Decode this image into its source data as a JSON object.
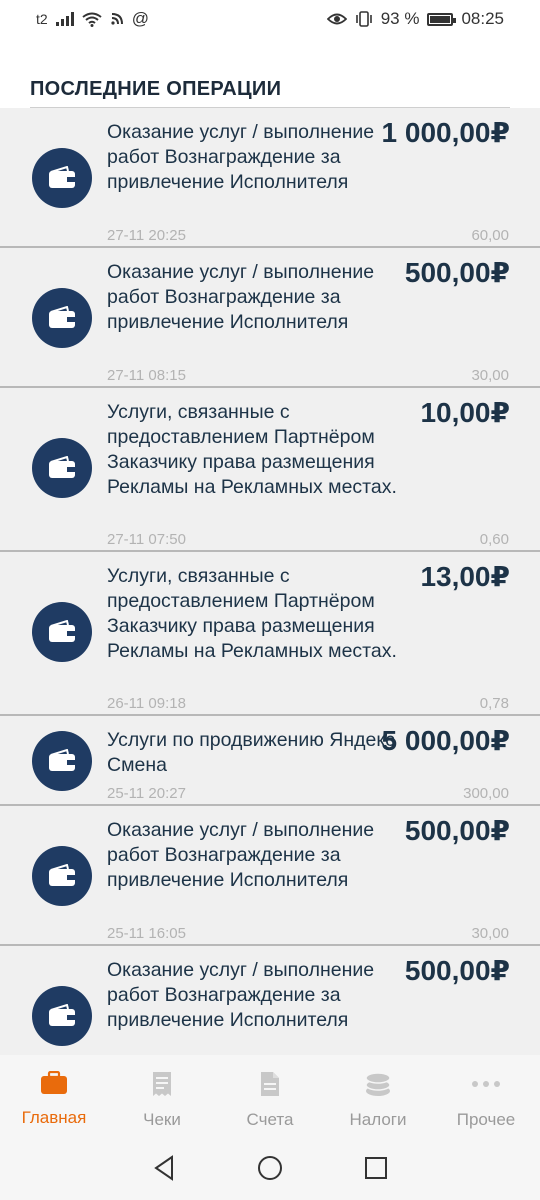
{
  "status_bar": {
    "carrier": "t2",
    "at_symbol": "@",
    "battery_percent": "93 %",
    "time": "08:25",
    "icons": [
      "signal-icon",
      "wifi-icon",
      "nfc-icon",
      "eye-icon",
      "vibrate-icon",
      "battery-icon"
    ]
  },
  "section": {
    "title": "ПОСЛЕДНИЕ ОПЕРАЦИИ"
  },
  "operations": [
    {
      "description": "Оказание услуг / выполнение работ Вознаграждение за привлечение Исполнителя",
      "amount": "1 000,00₽",
      "date": "27-11 20:25",
      "fee": "60,00"
    },
    {
      "description": "Оказание услуг / выполнение работ Вознаграждение за привлечение Исполнителя",
      "amount": "500,00₽",
      "date": "27-11 08:15",
      "fee": "30,00"
    },
    {
      "description": "Услуги, связанные с предоставлением Партнёром Заказчику права размещения Рекламы на Рекламных местах.",
      "amount": "10,00₽",
      "date": "27-11 07:50",
      "fee": "0,60"
    },
    {
      "description": "Услуги, связанные с предоставлением Партнёром Заказчику права размещения Рекламы на Рекламных местах.",
      "amount": "13,00₽",
      "date": "26-11 09:18",
      "fee": "0,78"
    },
    {
      "description": "Услуги по продвижению Яндекс Смена",
      "amount": "5 000,00₽",
      "date": "25-11 20:27",
      "fee": "300,00"
    },
    {
      "description": "Оказание услуг / выполнение работ Вознаграждение за привлечение Исполнителя",
      "amount": "500,00₽",
      "date": "25-11 16:05",
      "fee": "30,00"
    },
    {
      "description": "Оказание услуг / выполнение работ Вознаграждение за привлечение Исполнителя",
      "amount": "500,00₽",
      "date": "",
      "fee": ""
    }
  ],
  "bottom_nav": {
    "items": [
      {
        "label": "Главная",
        "icon": "briefcase-icon",
        "active": true
      },
      {
        "label": "Чеки",
        "icon": "receipt-icon",
        "active": false
      },
      {
        "label": "Счета",
        "icon": "document-icon",
        "active": false
      },
      {
        "label": "Налоги",
        "icon": "coins-icon",
        "active": false
      },
      {
        "label": "Прочее",
        "icon": "more-icon",
        "active": false
      }
    ]
  },
  "colors": {
    "accent": "#e96b0c",
    "avatar": "#1f3b63",
    "text_dark": "#1d3347",
    "muted": "#b3b3b3",
    "row_bg": "#f0f0f0"
  }
}
